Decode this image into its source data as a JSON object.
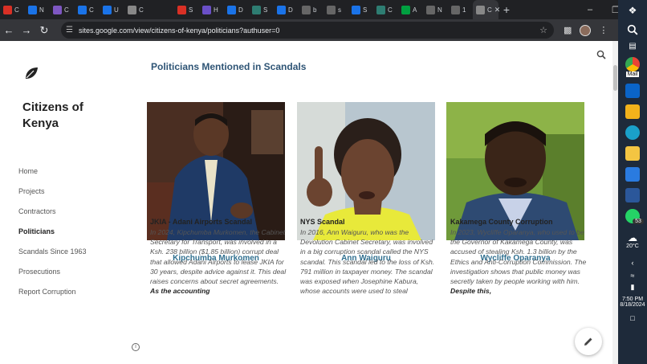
{
  "browser": {
    "tabs": [
      {
        "letter": "C",
        "color": "#d93025"
      },
      {
        "letter": "N",
        "color": "#1a73e8"
      },
      {
        "letter": "C",
        "color": "#7e57c2"
      },
      {
        "letter": "C",
        "color": "#1a73e8"
      },
      {
        "letter": "U",
        "color": "#1a73e8"
      },
      {
        "letter": "C",
        "color": "#888888"
      },
      {
        "letter": "",
        "color": "#202124"
      },
      {
        "letter": "S",
        "color": "#d93025"
      },
      {
        "letter": "H",
        "color": "#6a4fc7"
      },
      {
        "letter": "D",
        "color": "#1a73e8"
      },
      {
        "letter": "S",
        "color": "#2e7d72"
      },
      {
        "letter": "D",
        "color": "#1a73e8"
      },
      {
        "letter": "b",
        "color": "#666666"
      },
      {
        "letter": "s",
        "color": "#666666"
      },
      {
        "letter": "S",
        "color": "#1a73e8"
      },
      {
        "letter": "C",
        "color": "#2e7d72"
      },
      {
        "letter": "A",
        "color": "#00a040"
      },
      {
        "letter": "N",
        "color": "#666666"
      },
      {
        "letter": "1",
        "color": "#666666"
      },
      {
        "letter": "C",
        "color": "#888888"
      }
    ],
    "url": "sites.google.com/view/citizens-of-kenya/politicians?authuser=0"
  },
  "site": {
    "title": "Citizens of Kenya",
    "nav": [
      "Home",
      "Projects",
      "Contractors",
      "Politicians",
      "Scandals Since 1963",
      "Prosecutions",
      "Report Corruption"
    ],
    "active_nav": "Politicians"
  },
  "main": {
    "section_title": "Politicians Mentioned in Scandals",
    "cards": [
      {
        "name": "Kipchumba Murkomen",
        "scandal_title": "JKIA - Adani Airports Scandal",
        "body": "In 2024, Kipchumba Murkomen, the Cabinet Secretary for Transport, was involved in a Ksh. 238 billion ($1.85 billion) corrupt deal that allowed Adani Airports to lease JKIA for 30 years, despite advice against it. This deal raises concerns about secret agreements. ",
        "body_bold": "As the accounting"
      },
      {
        "name": "Ann Waiguru",
        "scandal_title": "NYS Scandal",
        "body": "In 2016, Ann Waiguru, who was the Devolution Cabinet Secretary, was involved in a big corruption scandal called the NYS scandal. This scandal led to the loss of Ksh. 791 million in taxpayer money. The scandal was exposed when Josephine Kabura, whose accounts were used to steal",
        "body_bold": ""
      },
      {
        "name": "Wycliffe Oparanya",
        "scandal_title": "Kakamega County Corruption",
        "body": "In 2023, Wycliffe Oparanya, who used to be the Governor of Kakamega County, was accused of stealing Ksh. 1.3 billion by the Ethics and Anti-Corruption Commission. The investigation shows that public money was secretly taken by people working with him. ",
        "body_bold": "Despite this,"
      }
    ]
  },
  "taskbar": {
    "mail_label": "Mail",
    "badge": "53",
    "temp": "20°C",
    "time": "7:50 PM",
    "date": "8/18/2024"
  }
}
